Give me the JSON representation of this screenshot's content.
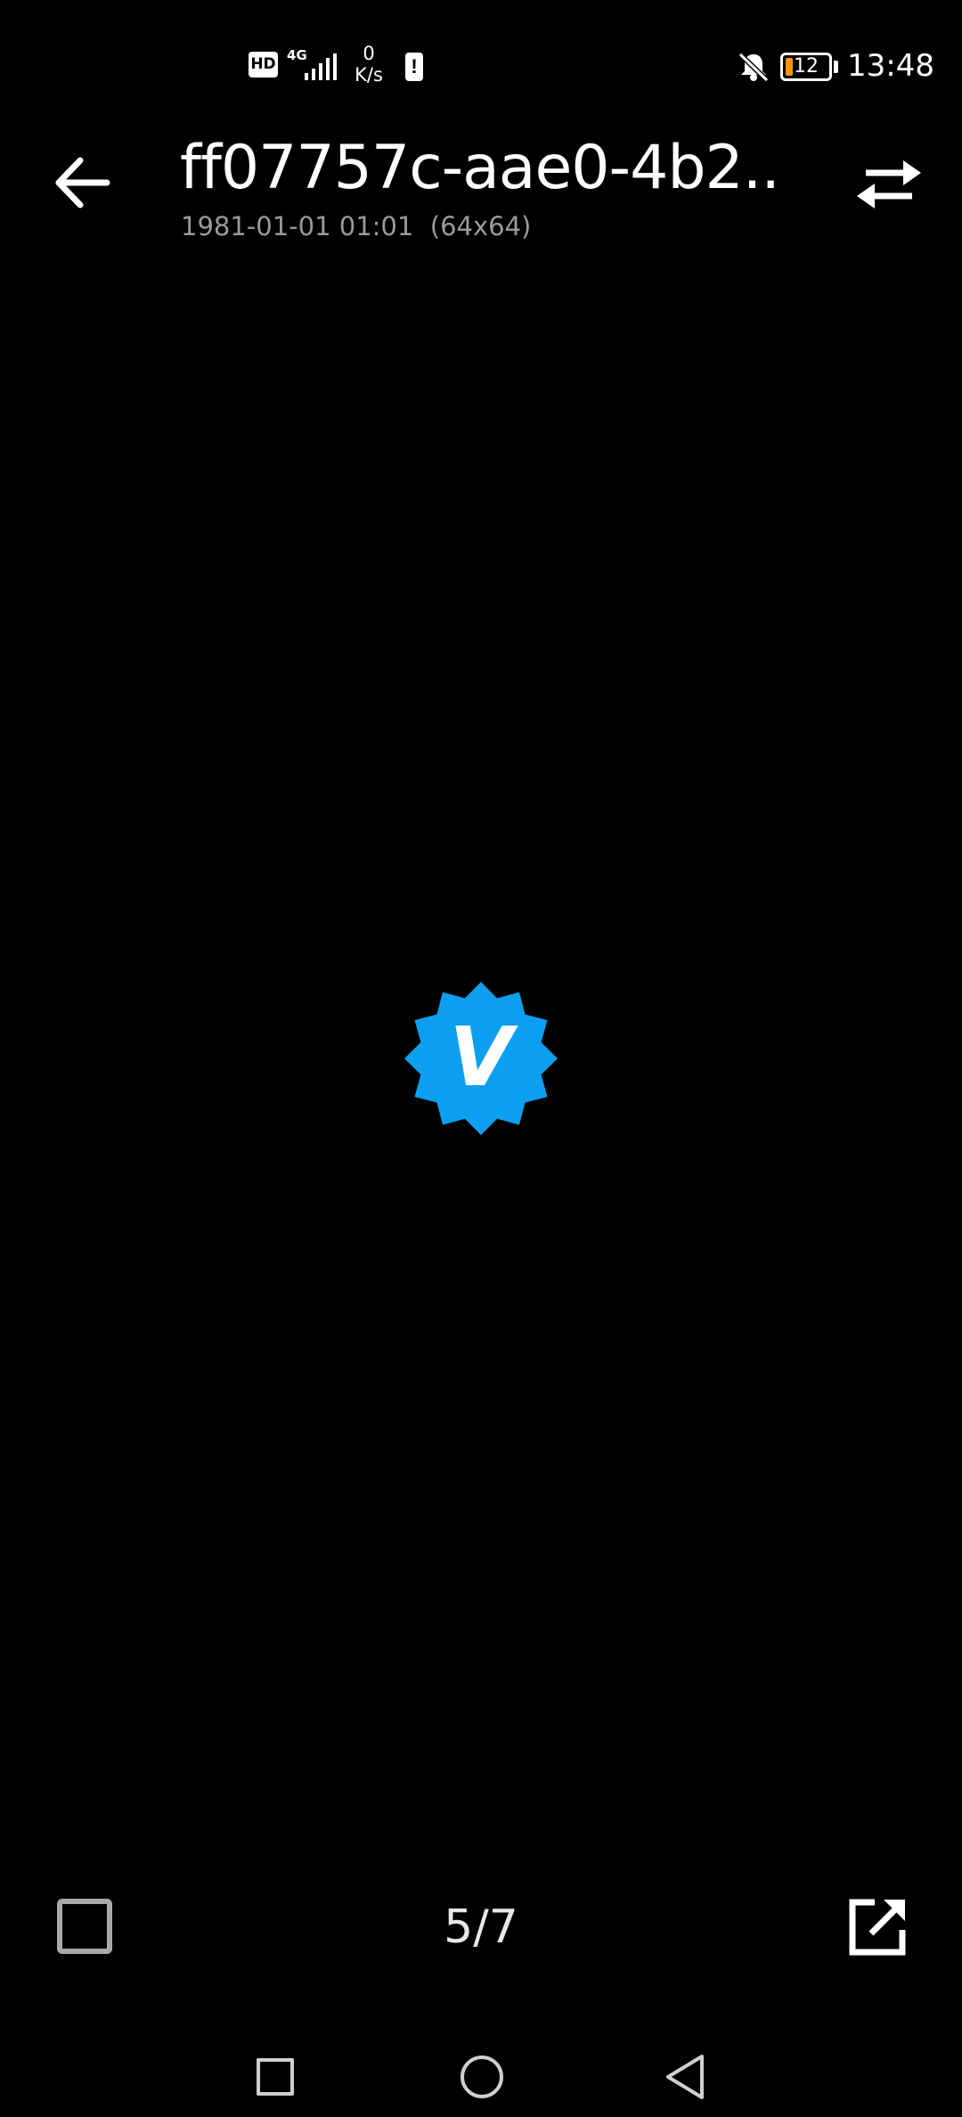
{
  "status_bar": {
    "hd_label": "HD",
    "network_label": "4G",
    "speed_value": "0",
    "speed_unit": "K/s",
    "alert_label": "!",
    "battery_level": "12",
    "time": "13:48",
    "icons": [
      "hd-icon",
      "signal-icon",
      "alert-icon",
      "bell-off-icon",
      "battery-icon"
    ]
  },
  "app_bar": {
    "title": "ff07757c-aae0-4b2...",
    "subtitle": "1981-01-01 01:01  (64x64)",
    "icons": [
      "arrow-left-icon",
      "swap-icon"
    ]
  },
  "viewer": {
    "badge_letter": "V",
    "badge_color": "#0c9ff0"
  },
  "bottom_bar": {
    "counter": "5/7",
    "icons": [
      "checkbox-icon",
      "open-external-icon"
    ]
  },
  "nav_bar": {
    "icons": [
      "recents-icon",
      "home-icon",
      "back-icon"
    ]
  },
  "colors": {
    "background": "#000000",
    "text": "#ffffff",
    "subtitle": "#9a9a9a",
    "battery_low": "#ff9500",
    "accent": "#0c9ff0"
  }
}
